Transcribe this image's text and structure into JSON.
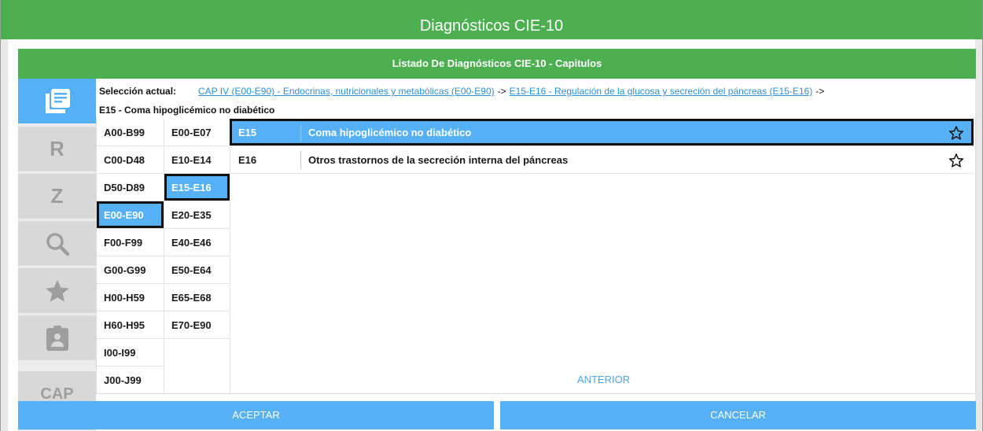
{
  "window": {
    "title": "Diagnósticos CIE-10"
  },
  "list_header": "Listado De Diagnósticos CIE-10 - Capitulos",
  "sidebar": {
    "items": [
      {
        "name": "list-icon",
        "label": ""
      },
      {
        "name": "r",
        "label": "R"
      },
      {
        "name": "z",
        "label": "Z"
      },
      {
        "name": "search-icon",
        "label": ""
      },
      {
        "name": "star-icon",
        "label": ""
      },
      {
        "name": "clipboard-icon",
        "label": ""
      },
      {
        "name": "cap",
        "label": "CAP"
      }
    ]
  },
  "selection": {
    "label": "Selección actual:",
    "crumb1": "CAP IV (E00-E90) - Endocrinas, nutricionales y metabólicas (E00-E90)",
    "arrow": "->",
    "crumb2": "E15-E16 - Regulación de la glucosa y secreción del páncreas (E15-E16)",
    "current": "E15 - Coma hipoglicémico no diabético"
  },
  "chapters": [
    "A00-B99",
    "C00-D48",
    "D50-D89",
    "E00-E90",
    "F00-F99",
    "G00-G99",
    "H00-H59",
    "H60-H95",
    "I00-I99",
    "J00-J99"
  ],
  "groups": [
    "E00-E07",
    "E10-E14",
    "E15-E16",
    "E20-E35",
    "E40-E46",
    "E50-E64",
    "E65-E68",
    "E70-E90"
  ],
  "diagnoses": [
    {
      "code": "E15",
      "desc": "Coma hipoglicémico no diabético"
    },
    {
      "code": "E16",
      "desc": "Otros trastornos de la secreción interna del páncreas"
    }
  ],
  "pagination": {
    "previous": "ANTERIOR"
  },
  "buttons": {
    "accept": "ACEPTAR",
    "cancel": "CANCELAR"
  },
  "colors": {
    "header_green": "#4caf50",
    "accent_blue": "#55b0f5",
    "link_blue": "#2e8fd6"
  }
}
